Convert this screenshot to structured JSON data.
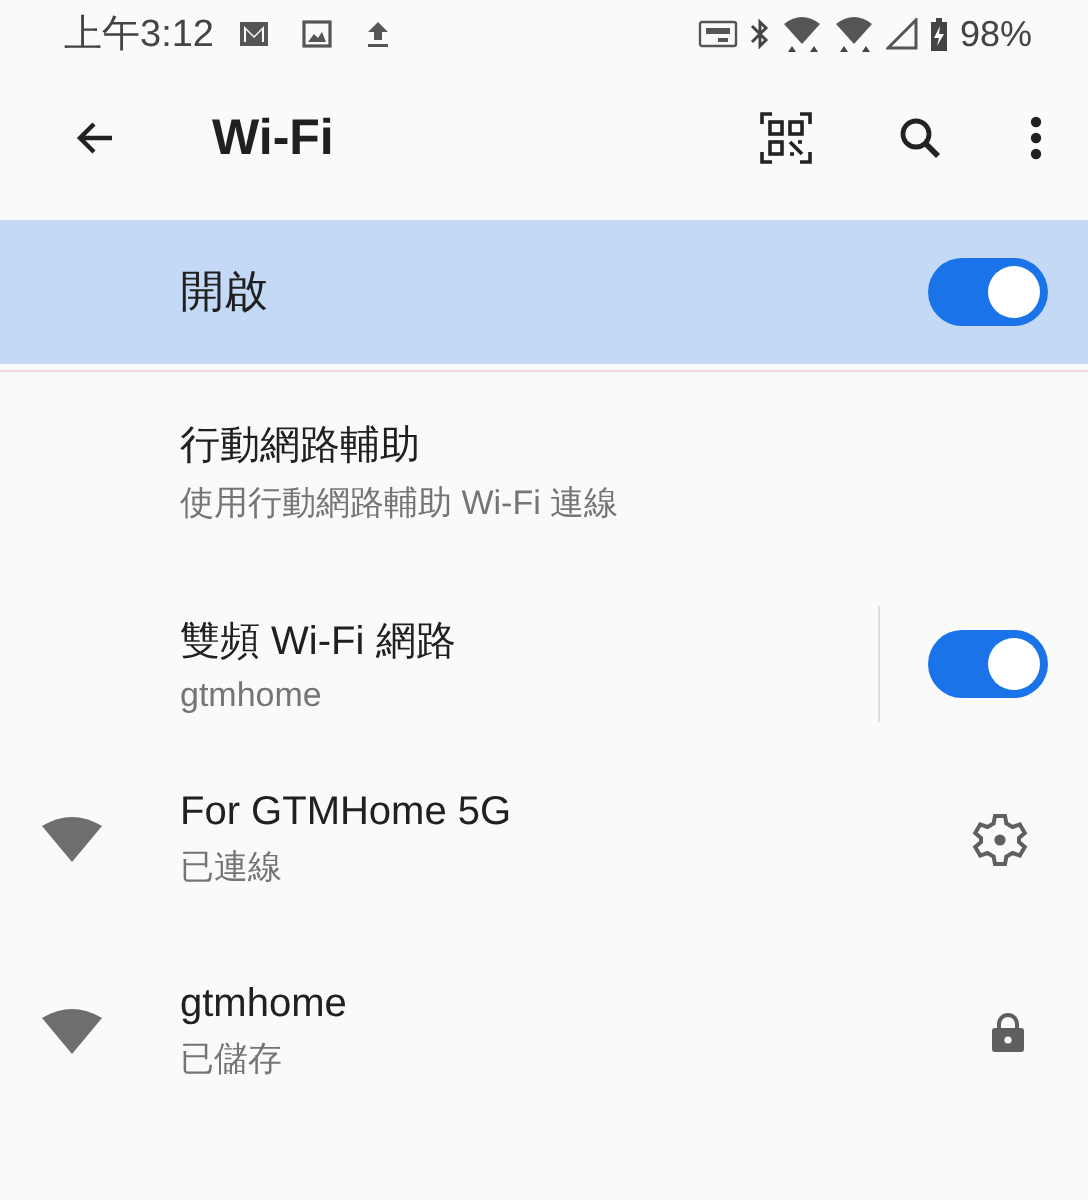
{
  "status_bar": {
    "time": "上午3:12",
    "battery": "98%"
  },
  "app_bar": {
    "title": "Wi-Fi"
  },
  "master_switch": {
    "label": "開啟",
    "on": true
  },
  "settings": [
    {
      "kind": "link",
      "title": "行動網路輔助",
      "subtitle": "使用行動網路輔助 Wi-Fi 連線"
    },
    {
      "kind": "switch",
      "title": "雙頻 Wi-Fi 網路",
      "subtitle": "gtmhome",
      "on": true
    }
  ],
  "networks": [
    {
      "name": "For GTMHome 5G",
      "status": "已連線",
      "kind": "connected"
    },
    {
      "name": "gtmhome",
      "status": "已儲存",
      "kind": "locked"
    }
  ]
}
